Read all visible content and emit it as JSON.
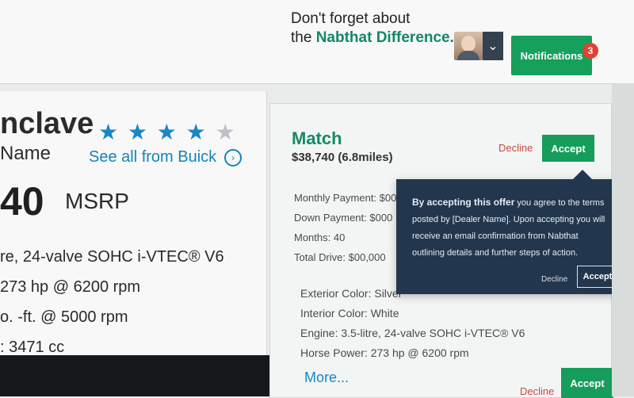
{
  "browser": {
    "star_icon": "star-icon",
    "menu_icon": "hamburger-icon"
  },
  "topbar": {
    "promo_line1": "Don't forget about",
    "promo_line2_prefix": "the",
    "promo_brand": "Nabthat Difference.",
    "notifications_label": "Notifications",
    "notifications_count": "3"
  },
  "vehicle": {
    "title": "nclave",
    "rating": 4,
    "rating_max": 5,
    "dealer_name": "Name",
    "see_all": "See all from Buick",
    "price": "40",
    "msrp": "MSRP",
    "specs": [
      "re, 24-valve SOHC i-VTEC® V6",
      "273 hp @ 6200 rpm",
      "o. -ft. @ 5000 rpm",
      ": 3471 cc"
    ]
  },
  "match": {
    "title": "Match",
    "price": "$38,740 (6.8miles)",
    "decline": "Decline",
    "accept": "Accept",
    "finance": [
      "Monthly Payment: $00",
      "Down Payment: $000",
      "Months: 40",
      "Total Drive: $00,000"
    ],
    "details": [
      "Exterior Color: Silver",
      "Interior Color: White",
      "Engine: 3.5-litre, 24-valve SOHC i-VTEC® V6",
      "Horse Power: 273 hp @ 6200 rpm"
    ],
    "more": "More...",
    "decline_bottom": "Decline",
    "accept_bottom": "Accept"
  },
  "popover": {
    "lead": "By accepting this offer",
    "body": " you agree to the terms posted by [Dealer Name]. Upon accepting you will receive an email confirmation from Nabthat outlining details and further steps of action.",
    "decline": "Decline",
    "accept": "Accept"
  }
}
